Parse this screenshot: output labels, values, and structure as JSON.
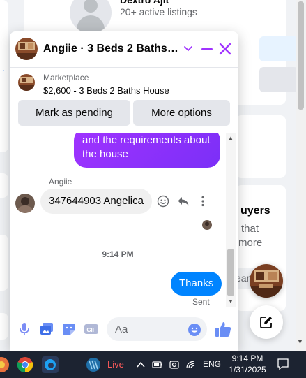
{
  "background": {
    "seller_name": "Dextro Ajit",
    "seller_listings": "20+ active listings",
    "buyers_heading": "uyers",
    "buyers_line1": "that",
    "buyers_line2": "more",
    "search_fragment": "ear"
  },
  "chat": {
    "title": "Angiie · 3 Beds 2 Baths Ho...",
    "accent_color": "#a033ff",
    "listing": {
      "source": "Marketplace",
      "title": "$2,600 - 3 Beds 2 Baths House"
    },
    "buttons": {
      "mark_pending": "Mark as pending",
      "more_options": "More options"
    },
    "messages": {
      "outgoing_partial": "and the requirements about the house",
      "sender_name": "Angiie",
      "incoming": "347644903 Angelica",
      "time_divider": "9:14 PM",
      "outgoing_last": "Thanks",
      "status": "Sent"
    },
    "composer": {
      "placeholder": "Aa"
    }
  },
  "taskbar": {
    "live_label": "Live",
    "language": "ENG",
    "time": "9:14 PM",
    "date": "1/31/2025"
  }
}
